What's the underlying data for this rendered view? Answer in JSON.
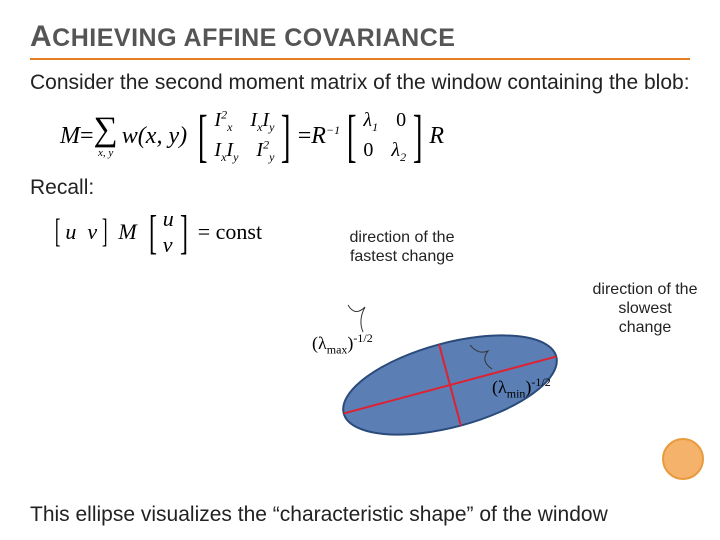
{
  "title": {
    "pre": "A",
    "rest": "CHIEVING AFFINE COVARIANCE"
  },
  "intro": "Consider the second moment matrix of the window containing the blob:",
  "eq": {
    "M": "M",
    "eq_sign": " = ",
    "sum": "∑",
    "sum_sub": "x, y",
    "w": "w(x, y)",
    "mat1": {
      "r1c1": "I",
      "r1c1_sub": "x",
      "r1c1_sup": "2",
      "r1c2a": "I",
      "r1c2a_sub": "x",
      "r1c2b": "I",
      "r1c2b_sub": "y",
      "r2c1a": "I",
      "r2c1a_sub": "x",
      "r2c1b": "I",
      "r2c1b_sub": "y",
      "r2c2": "I",
      "r2c2_sub": "y",
      "r2c2_sup": "2"
    },
    "Rinv": "R",
    "Rinv_sup": "−1",
    "mat2": {
      "l1": "λ",
      "l1_sub": "1",
      "zero1": "0",
      "zero2": "0",
      "l2": "λ",
      "l2_sub": "2"
    },
    "R": "R"
  },
  "dir_fast": "direction of the fastest change",
  "dir_slow": "direction of the slowest change",
  "recall": "Recall:",
  "eq2": {
    "uv": {
      "u": "u",
      "v": "v"
    },
    "M": "M",
    "col": {
      "u": "u",
      "v": "v"
    },
    "rhs": "= const"
  },
  "lambda_max": {
    "open": "(λ",
    "sub": "max",
    "close": ")",
    "pw": "-1/2"
  },
  "lambda_min": {
    "open": "(λ",
    "sub": "min",
    "close": ")",
    "pw": "-1/2"
  },
  "footer": "This ellipse visualizes the “characteristic shape” of the window"
}
